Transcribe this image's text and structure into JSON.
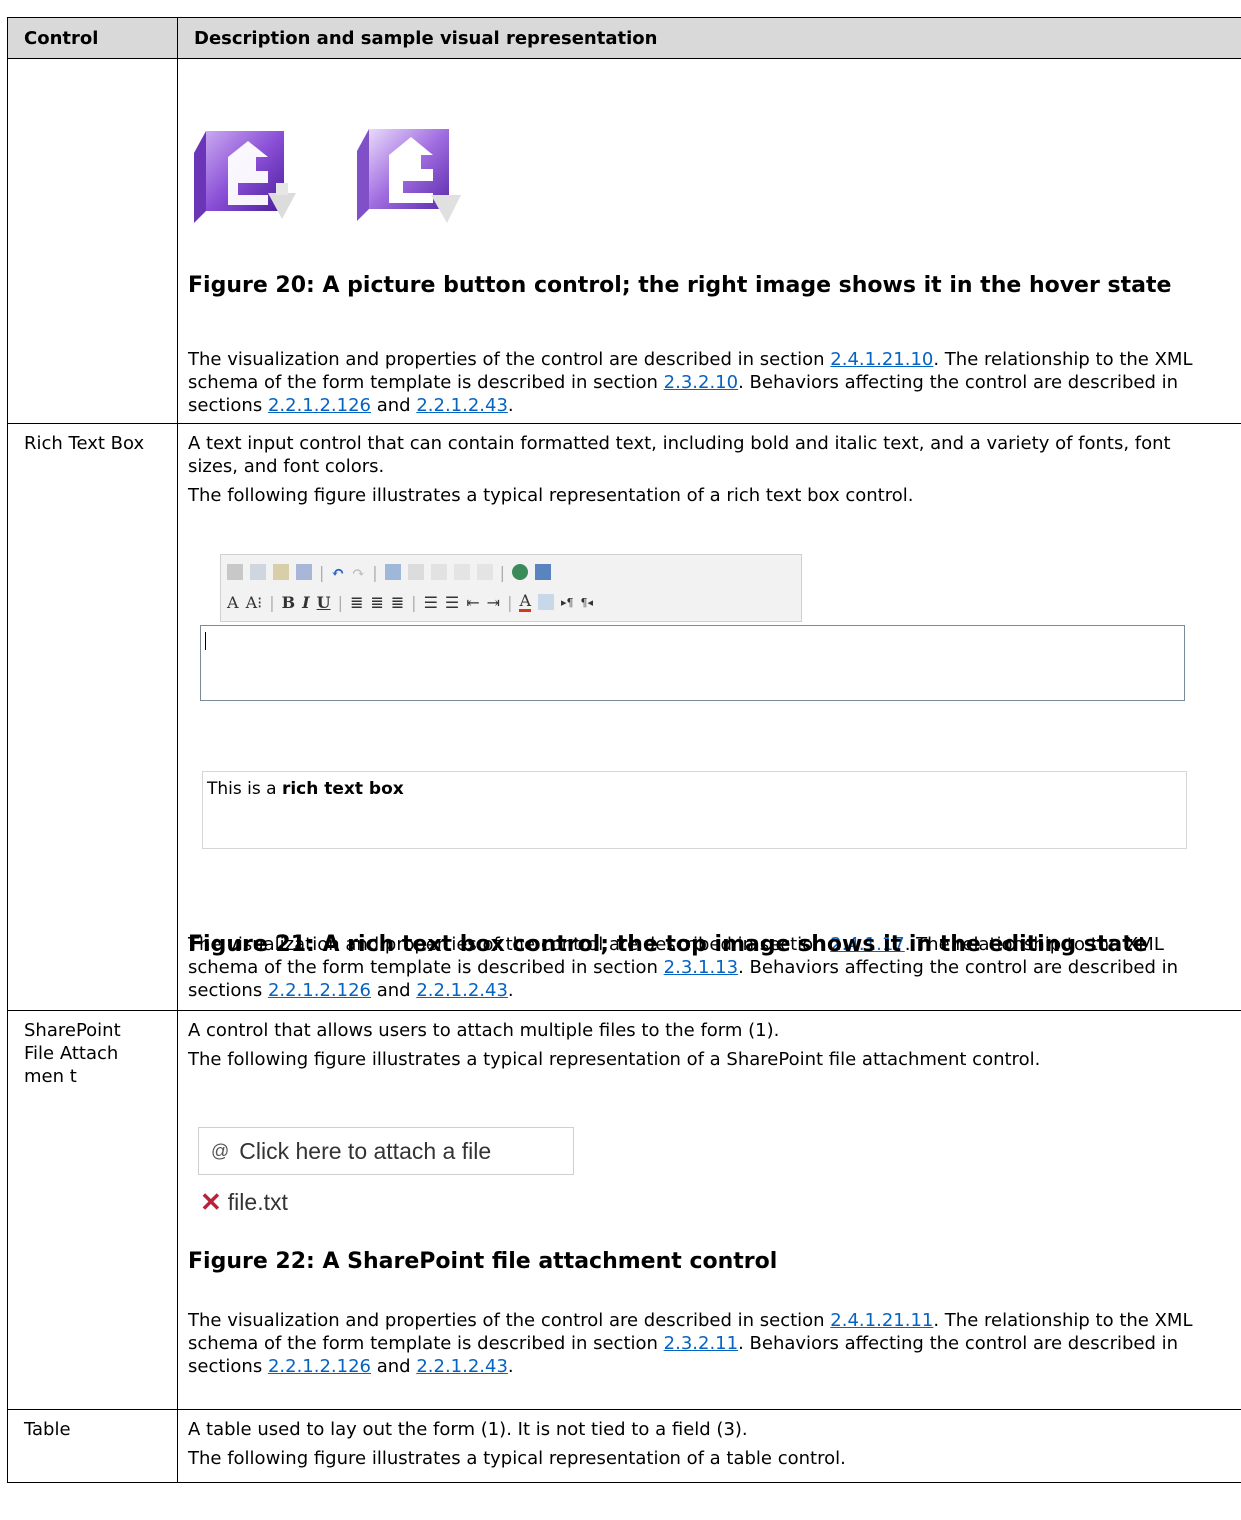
{
  "header": {
    "col1": "Control",
    "col2": "Description and sample visual representation"
  },
  "rows": {
    "picture_button": {
      "caption": "Figure 20: A picture button control; the right image shows it in the hover state",
      "p_prefix": "The visualization and properties of the control are described in section ",
      "link_vis": "2.4.1.21.10",
      "p_mid1": ". The relationship to the XML schema of the form template is described in section ",
      "link_schema": "2.3.2.10",
      "p_mid2": ". Behaviors affecting the control are described in sections ",
      "link_b1": "2.2.1.2.126",
      "p_and": " and ",
      "link_b2": "2.2.1.2.43",
      "p_end": "."
    },
    "rich_text_box": {
      "control": "Rich Text Box",
      "intro": "A text input control that can contain formatted text, including bold and italic text, and a variety of fonts, font sizes, and font colors.",
      "fig_intro": "The following figure illustrates a typical representation of a rich text box control.",
      "sample_prefix": "This is a ",
      "sample_bold": "rich text box",
      "caption": "Figure 21: A rich text box control; the top image shows it in the editing state",
      "p_prefix": "The visualization and properties of the control are described in section ",
      "link_vis": "2.4.1.17",
      "p_mid1": ". The relationship to the XML schema of the form template is described in section ",
      "link_schema": "2.3.1.13",
      "p_mid2": ". Behaviors affecting the control are described in sections ",
      "link_b1": "2.2.1.2.126",
      "p_and": " and ",
      "link_b2": "2.2.1.2.43",
      "p_end": "."
    },
    "file_attachment": {
      "control": "SharePoint File Attachmen t",
      "intro": "A control that allows users to attach multiple files to the form (1).",
      "fig_intro": "The following figure illustrates a typical representation of a SharePoint file attachment control.",
      "attach_label": "Click here to attach a file",
      "file_name": "file.txt",
      "caption": "Figure 22: A SharePoint file attachment control",
      "p_prefix": "The visualization and properties of the control are described in section ",
      "link_vis": "2.4.1.21.11",
      "p_mid1": ". The relationship to the XML schema of the form template is described in section ",
      "link_schema": "2.3.2.11",
      "p_mid2": ". Behaviors affecting the control are described in sections ",
      "link_b1": "2.2.1.2.126",
      "p_and": " and ",
      "link_b2": "2.2.1.2.43",
      "p_end": "."
    },
    "table": {
      "control": "Table",
      "intro": "A table used to lay out the form (1). It is not tied to a field (3).",
      "fig_intro": "The following figure illustrates a typical representation of a table control."
    }
  },
  "toolbar_row2": {
    "font_a": "A",
    "font_ab": "A⁝",
    "bold": "B",
    "italic": "I",
    "underline": "U"
  }
}
